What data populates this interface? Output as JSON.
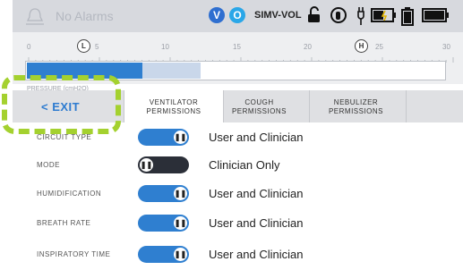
{
  "status_bar": {
    "alarm_text": "No Alarms",
    "indicators": [
      {
        "letter": "V",
        "color": "#2f6fd0"
      },
      {
        "letter": "O",
        "color": "#2aa7e8"
      }
    ],
    "mode": "SIMV-VOL",
    "icons": [
      "unlock-icon",
      "touch-lock-icon",
      "plug-icon",
      "battery-charging-icon",
      "battery-icon",
      "battery-full-icon"
    ]
  },
  "pressure_scale": {
    "ticks": [
      "0",
      "5",
      "10",
      "15",
      "20",
      "25",
      "30"
    ],
    "low_marker": {
      "label": "L",
      "value": 5
    },
    "high_marker": {
      "label": "H",
      "value": 25
    },
    "fill_value": 8.3,
    "secondary_fill_value": 12.5,
    "max": 30,
    "label": "PRESSURE (cmH2O)"
  },
  "exit": {
    "label": "< EXIT"
  },
  "tabs": [
    {
      "line1": "VENTILATOR",
      "line2": "PERMISSIONS",
      "active": true
    },
    {
      "line1": "COUGH",
      "line2": "PERMISSIONS",
      "active": false
    },
    {
      "line1": "NEBULIZER",
      "line2": "PERMISSIONS",
      "active": false
    }
  ],
  "rows": [
    {
      "label": "CIRCUIT TYPE",
      "state": "on",
      "value": "User and Clinician"
    },
    {
      "label": "MODE",
      "state": "off",
      "value": "Clinician Only"
    },
    {
      "label": "HUMIDIFICATION",
      "state": "on",
      "value": "User and Clinician"
    },
    {
      "label": "BREATH RATE",
      "state": "on",
      "value": "User and Clinician"
    },
    {
      "label": "INSPIRATORY TIME",
      "state": "on",
      "value": "User and Clinician"
    }
  ],
  "colors": {
    "toggle_on": "#2f7fd0",
    "toggle_off": "#2b2f38",
    "accent": "#2d7bd0",
    "highlight": "#a4d12f"
  }
}
